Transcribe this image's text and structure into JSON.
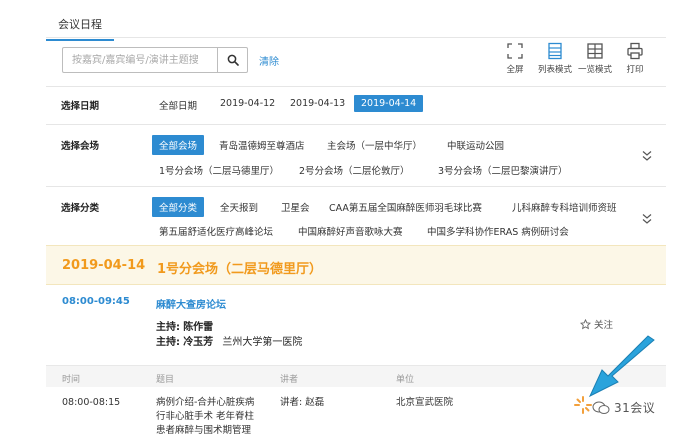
{
  "tabs": {
    "active_label": "会议日程"
  },
  "search": {
    "placeholder": "按嘉宾/嘉宾编号/演讲主题搜",
    "value": ""
  },
  "clear_label": "清除",
  "toolbar": [
    {
      "label": "全屏",
      "icon": "fullscreen-icon"
    },
    {
      "label": "列表模式",
      "icon": "list-mode-icon"
    },
    {
      "label": "一览模式",
      "icon": "grid-mode-icon"
    },
    {
      "label": "打印",
      "icon": "printer-icon"
    }
  ],
  "date_filter": {
    "label": "选择日期",
    "options": [
      "全部日期",
      "2019-04-12",
      "2019-04-13",
      "2019-04-14"
    ],
    "selected_index": 3
  },
  "venue_filter": {
    "label": "选择会场",
    "options": [
      "全部会场",
      "青岛温德姆至尊酒店",
      "主会场（一层中华厅）",
      "中联运动公园",
      "1号分会场（二层马德里厅）",
      "2号分会场（二层伦敦厅）",
      "3号分会场（二层巴黎演讲厅）"
    ],
    "selected_index": 0
  },
  "category_filter": {
    "label": "选择分类",
    "options": [
      "全部分类",
      "全天报到",
      "卫星会",
      "CAA第五届全国麻醉医师羽毛球比赛",
      "儿科麻醉专科培训师资班",
      "第五届舒适化医疗高峰论坛",
      "中国麻醉好声音歌咏大赛",
      "中国多学科协作ERAS 病例研讨会"
    ],
    "selected_index": 0
  },
  "session": {
    "date": "2019-04-14",
    "hall": "1号分会场（二层马德里厅）",
    "time": "08:00-09:45",
    "title": "麻醉大查房论坛",
    "host_prefix": "主持:",
    "hosts": [
      {
        "name": "陈作雷",
        "org": ""
      },
      {
        "name": "冷玉芳",
        "org": "兰州大学第一医院"
      }
    ],
    "follow_label": "关注"
  },
  "table": {
    "headers": [
      "时间",
      "题目",
      "讲者",
      "单位"
    ],
    "rows": [
      {
        "time": "08:00-08:15",
        "title_lines": [
          "病例介绍-合并心脏疾病",
          "行非心脏手术 老年脊柱",
          "患者麻醉与围术期管理"
        ],
        "speaker": "讲者: 赵磊",
        "unit": "北京宣武医院"
      }
    ]
  },
  "watermark": {
    "text": "31会议"
  },
  "colors": {
    "accent": "#2d8bd1",
    "orange": "#f19a1d",
    "band": "#fcf7e7"
  }
}
